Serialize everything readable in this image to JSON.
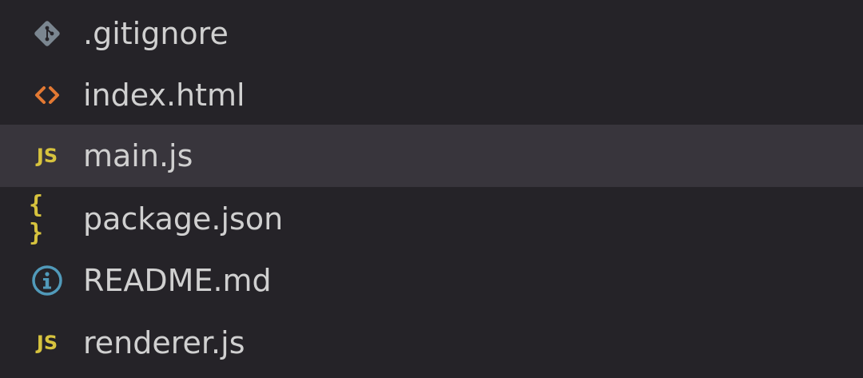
{
  "explorer": {
    "files": [
      {
        "name": ".gitignore",
        "icon": "git-diamond-icon",
        "icon_color": "#7b8690"
      },
      {
        "name": "index.html",
        "icon": "html-angle-brackets-icon",
        "icon_color": "#e37933"
      },
      {
        "name": "main.js",
        "icon": "js-icon",
        "icon_label": "JS",
        "icon_color": "#d7c33e",
        "selected": true
      },
      {
        "name": "package.json",
        "icon": "json-braces-icon",
        "icon_label": "{ }",
        "icon_color": "#d7c33e"
      },
      {
        "name": "README.md",
        "icon": "info-circle-icon",
        "icon_color": "#519aba"
      },
      {
        "name": "renderer.js",
        "icon": "js-icon",
        "icon_label": "JS",
        "icon_color": "#d7c33e"
      }
    ],
    "selected_bg": "#38353c",
    "background": "#252328"
  }
}
